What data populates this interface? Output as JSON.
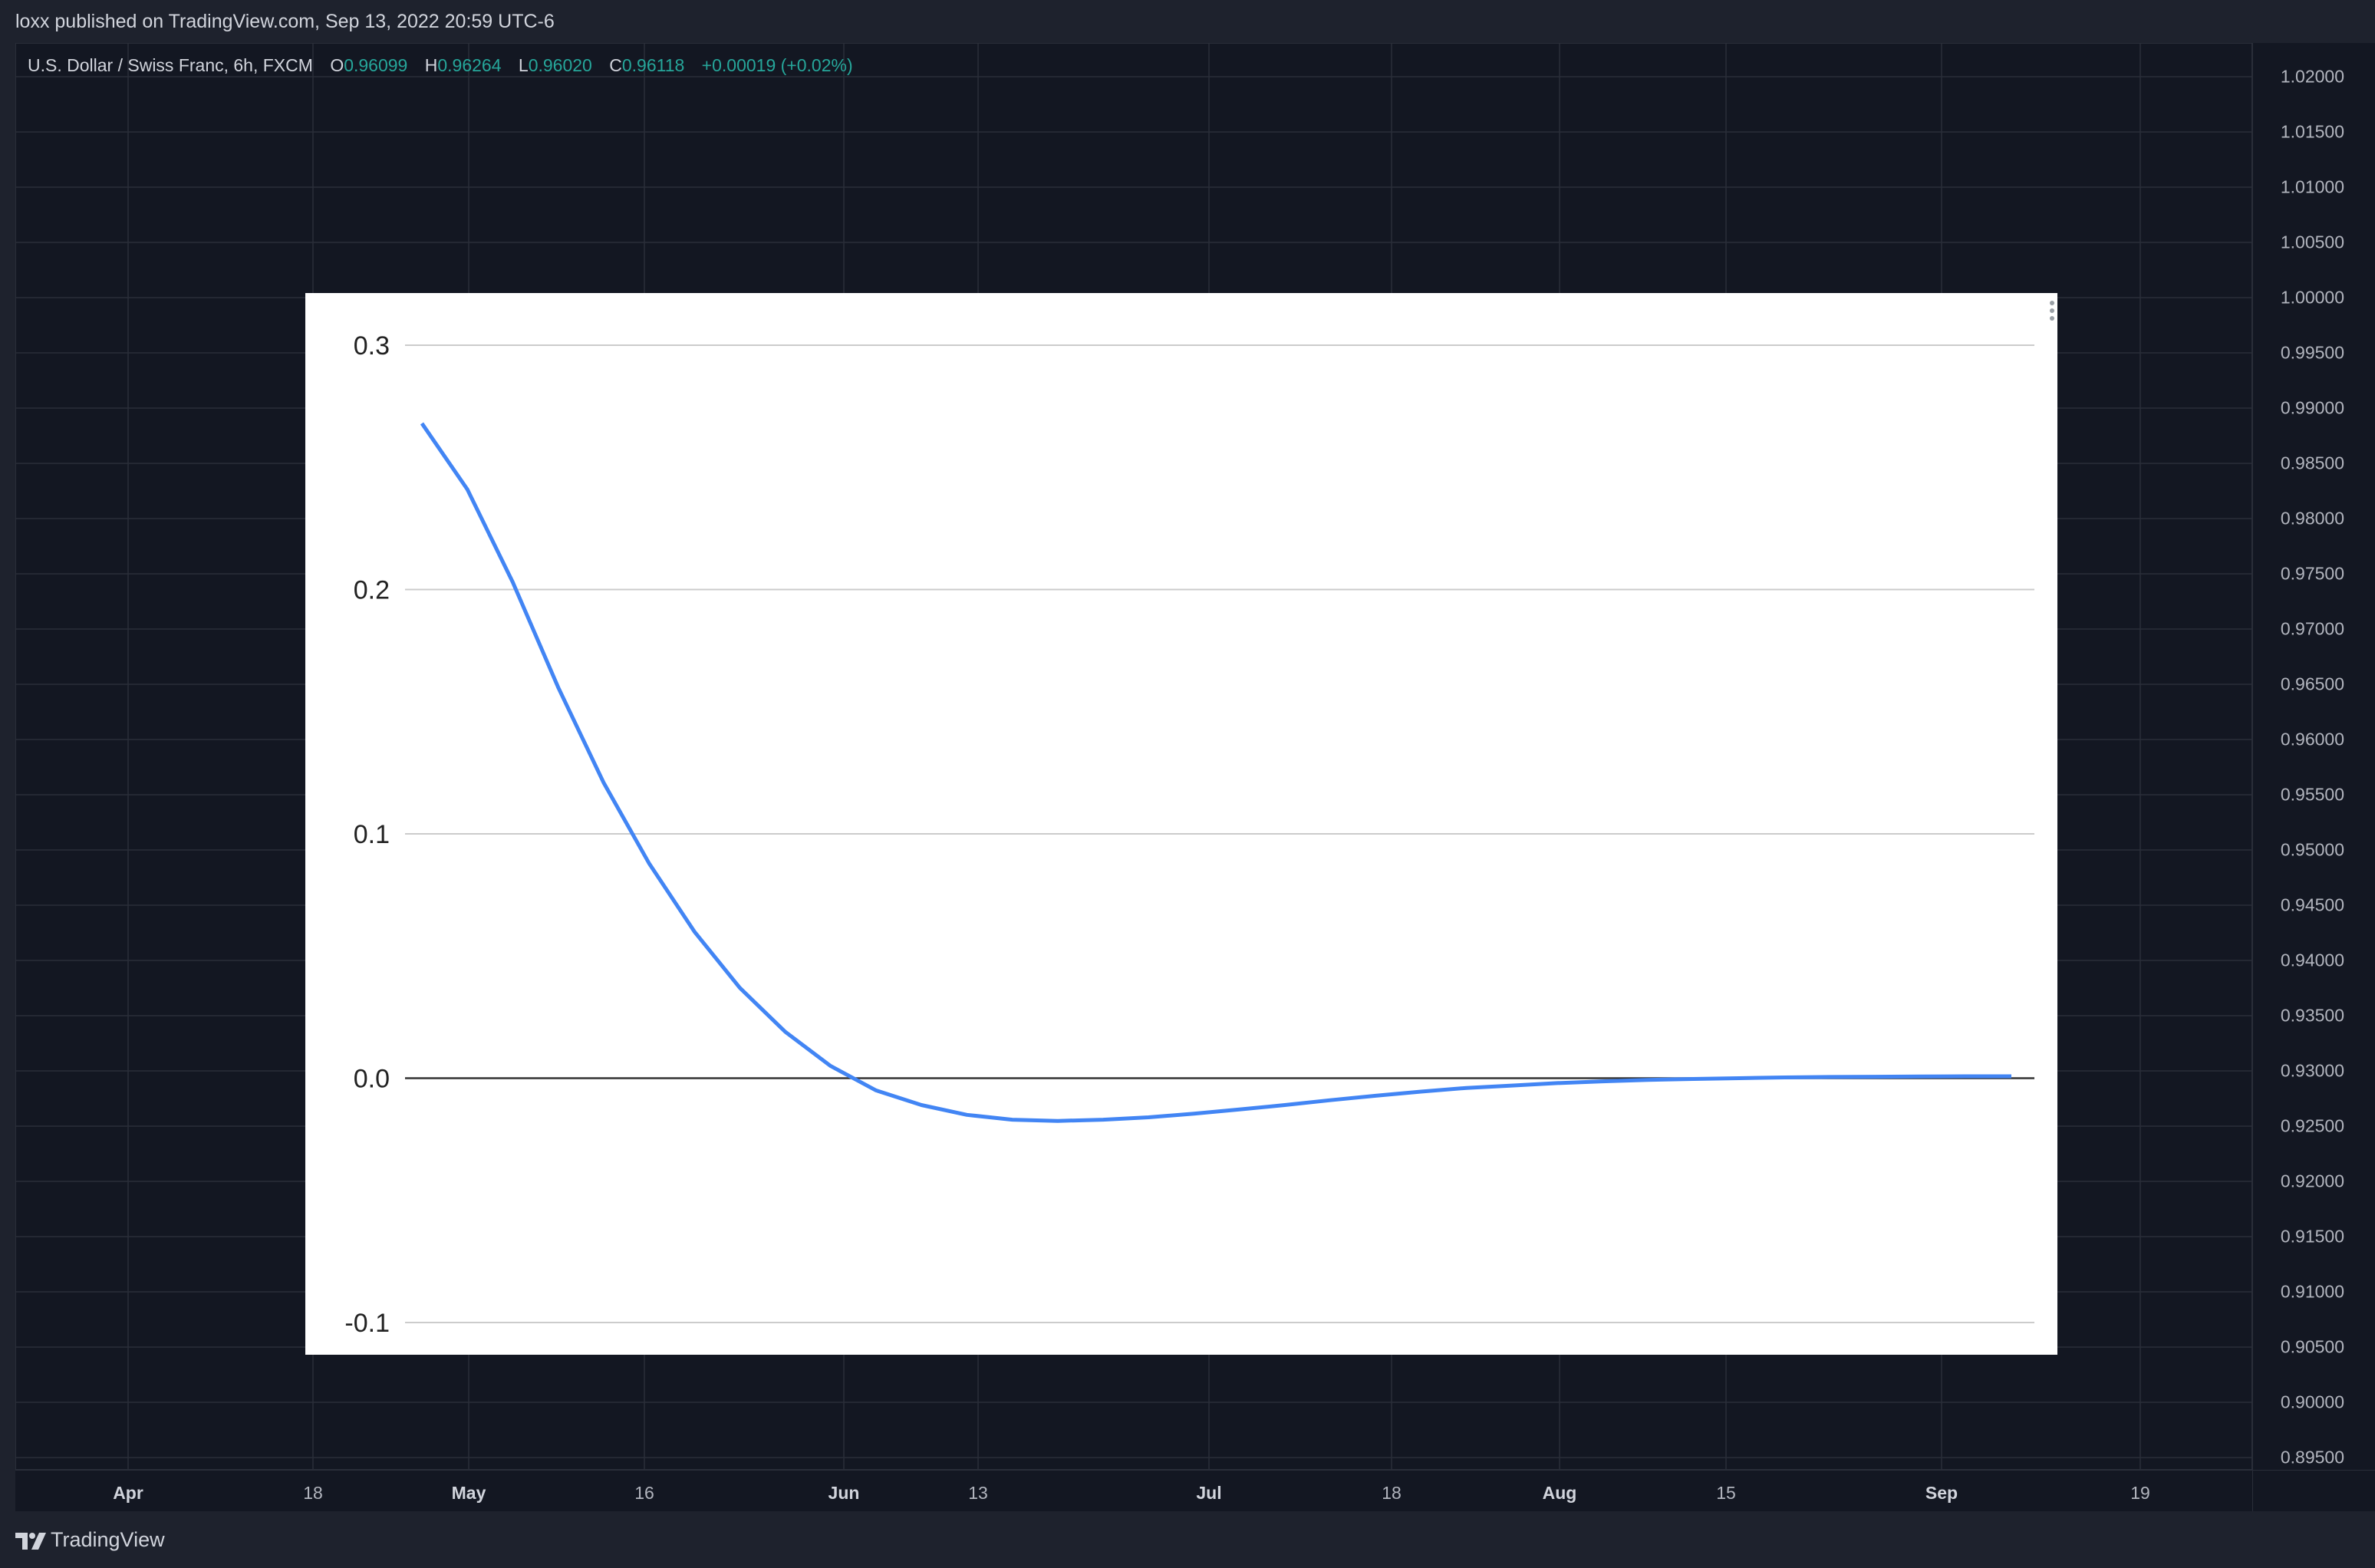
{
  "header": {
    "published_text": "loxx published on TradingView.com, Sep 13, 2022 20:59 UTC-6"
  },
  "legend": {
    "symbol": "U.S. Dollar / Swiss Franc, 6h, FXCM",
    "open_label": "O",
    "open_value": "0.96099",
    "high_label": "H",
    "high_value": "0.96264",
    "low_label": "L",
    "low_value": "0.96020",
    "close_label": "C",
    "close_value": "0.96118",
    "change": "+0.00019 (+0.02%)"
  },
  "price_axis": {
    "labels": [
      "1.02000",
      "1.01500",
      "1.01000",
      "1.00500",
      "1.00000",
      "0.99500",
      "0.99000",
      "0.98500",
      "0.98000",
      "0.97500",
      "0.97000",
      "0.96500",
      "0.96000",
      "0.95500",
      "0.95000",
      "0.94500",
      "0.94000",
      "0.93500",
      "0.93000",
      "0.92500",
      "0.92000",
      "0.91500",
      "0.91000",
      "0.90500",
      "0.90000",
      "0.89500"
    ]
  },
  "time_axis": {
    "labels": [
      {
        "text": "Apr",
        "major": true
      },
      {
        "text": "18",
        "major": false
      },
      {
        "text": "May",
        "major": true
      },
      {
        "text": "16",
        "major": false
      },
      {
        "text": "Jun",
        "major": true
      },
      {
        "text": "13",
        "major": false
      },
      {
        "text": "Jul",
        "major": true
      },
      {
        "text": "18",
        "major": false
      },
      {
        "text": "Aug",
        "major": true
      },
      {
        "text": "15",
        "major": false
      },
      {
        "text": "Sep",
        "major": true
      },
      {
        "text": "19",
        "major": false
      }
    ]
  },
  "footer": {
    "brand": "TradingView"
  },
  "colors": {
    "background": "#131722",
    "accent_green": "#26a69a",
    "line_blue": "#4285f4"
  },
  "chart_data": {
    "type": "line",
    "title": "",
    "xlabel": "",
    "ylabel": "",
    "ylim": [
      -0.1,
      0.3
    ],
    "yticks": [
      "0.3",
      "0.2",
      "0.1",
      "0.0",
      "-0.1"
    ],
    "grid": true,
    "series": [
      {
        "values": [
          0.268,
          0.241,
          0.203,
          0.16,
          0.121,
          0.088,
          0.06,
          0.037,
          0.019,
          0.005,
          -0.005,
          -0.011,
          -0.015,
          -0.017,
          -0.0175,
          -0.017,
          -0.016,
          -0.0145,
          -0.0128,
          -0.011,
          -0.009,
          -0.0072,
          -0.0055,
          -0.004,
          -0.003,
          -0.002,
          -0.0013,
          -0.0007,
          -0.0003,
          0.0,
          0.0003,
          0.0005,
          0.0006,
          0.0007,
          0.0008,
          0.0008
        ]
      }
    ]
  }
}
